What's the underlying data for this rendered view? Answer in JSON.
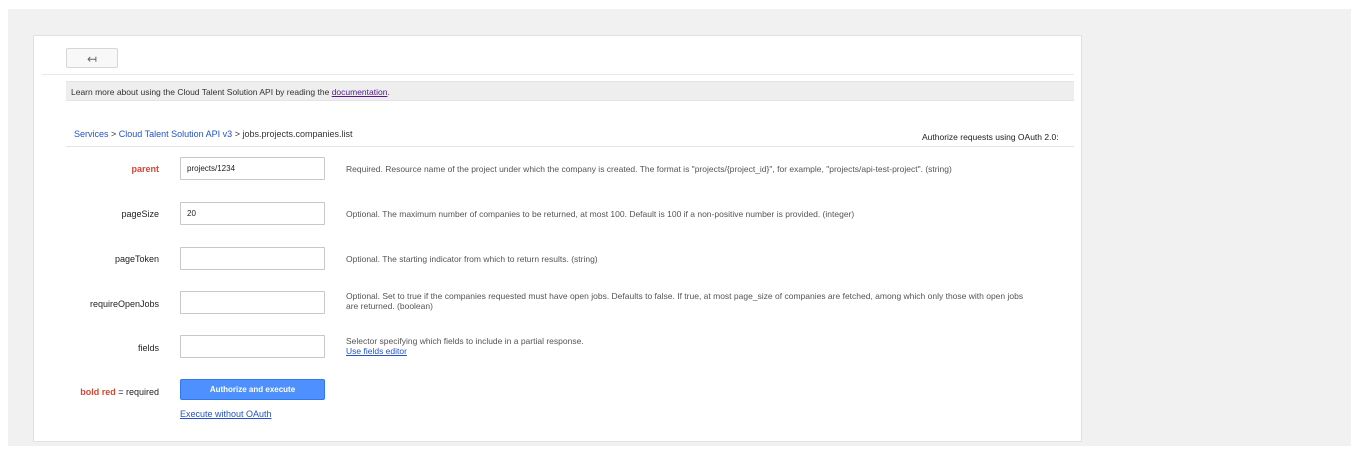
{
  "nav": {
    "back_icon": "↤"
  },
  "info": {
    "text_before": "Learn more about using the Cloud Talent Solution API by reading the ",
    "link_text": "documentation",
    "text_after": "."
  },
  "breadcrumb": {
    "services": "Services",
    "sep1": " > ",
    "api": "Cloud Talent Solution API v3",
    "sep2": " > ",
    "method": "jobs.projects.companies.list"
  },
  "authorize_text": "Authorize requests using OAuth 2.0:",
  "fields": [
    {
      "label": "parent",
      "required": true,
      "value": "projects/1234",
      "desc1": "Required. Resource name of the project under which the company is created. The format is \"projects/{project_id}\", for example, \"projects/api-test-project\". (string)",
      "desc2": ""
    },
    {
      "label": "pageSize",
      "required": false,
      "value": "20",
      "desc1": "Optional. The maximum number of companies to be returned, at most 100. Default is 100 if a non-positive number is provided. (integer)",
      "desc2": ""
    },
    {
      "label": "pageToken",
      "required": false,
      "value": "",
      "desc1": "Optional. The starting indicator from which to return results. (string)",
      "desc2": ""
    },
    {
      "label": "requireOpenJobs",
      "required": false,
      "value": "",
      "desc1": "Optional. Set to true if the companies requested must have open jobs. Defaults to false. If true, at most page_size of companies are fetched, among which only those with open jobs",
      "desc2": "are returned. (boolean)"
    },
    {
      "label": "fields",
      "required": false,
      "value": "",
      "desc1": "Selector specifying which fields to include in a partial response.",
      "desc2": "Use fields editor"
    }
  ],
  "legend": {
    "bold_red": "bold red",
    "rest": " = required"
  },
  "buttons": {
    "authorize_execute": "Authorize and execute",
    "execute_without_oauth": "Execute without OAuth"
  },
  "colors": {
    "required_label": "#d14836",
    "primary_button": "#4d90fe",
    "link": "#2452c7"
  }
}
